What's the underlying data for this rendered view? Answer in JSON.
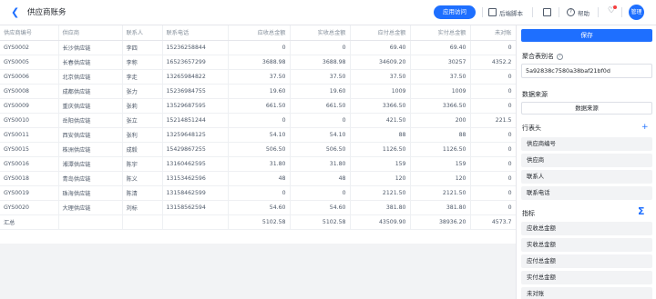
{
  "header": {
    "title": "供应商账务",
    "preview_label": "应用访问",
    "script_label": "后端脚本",
    "help_label": "帮助",
    "avatar_text": "管理"
  },
  "table": {
    "columns": [
      "供应商编号",
      "供应商",
      "联系人",
      "联系电话",
      "应收总金额",
      "实收总金额",
      "应付总金额",
      "实付总金额",
      "未对账"
    ],
    "rows": [
      [
        "GYS0002",
        "长沙供应链",
        "李四",
        "15236258844",
        "0",
        "0",
        "69.40",
        "69.40",
        "0"
      ],
      [
        "GYS0005",
        "长春供应链",
        "李称",
        "16523657299",
        "3688.98",
        "3688.98",
        "34609.20",
        "30257",
        "4352.2"
      ],
      [
        "GYS0006",
        "北京供应链",
        "李走",
        "13265984822",
        "37.50",
        "37.50",
        "37.50",
        "37.50",
        "0"
      ],
      [
        "GYS0008",
        "成都供应链",
        "张力",
        "15236984755",
        "19.60",
        "19.60",
        "1009",
        "1009",
        "0"
      ],
      [
        "GYS0009",
        "重庆供应链",
        "张莉",
        "13529687595",
        "661.50",
        "661.50",
        "3366.50",
        "3366.50",
        "0"
      ],
      [
        "GYS0010",
        "岳阳供应链",
        "张立",
        "15214851244",
        "0",
        "0",
        "421.50",
        "200",
        "221.5"
      ],
      [
        "GYS0011",
        "西安供应链",
        "张利",
        "13259648125",
        "54.10",
        "54.10",
        "88",
        "88",
        "0"
      ],
      [
        "GYS0015",
        "株洲供应链",
        "成毅",
        "15429867255",
        "506.50",
        "506.50",
        "1126.50",
        "1126.50",
        "0"
      ],
      [
        "GYS0016",
        "湘潭供应链",
        "陈宇",
        "13160462595",
        "31.80",
        "31.80",
        "159",
        "159",
        "0"
      ],
      [
        "GYS0018",
        "青岛供应链",
        "陈义",
        "13153462596",
        "48",
        "48",
        "120",
        "120",
        "0"
      ],
      [
        "GYS0019",
        "珠海供应链",
        "陈清",
        "13158462599",
        "0",
        "0",
        "2121.50",
        "2121.50",
        "0"
      ],
      [
        "GYS0020",
        "大理供应链",
        "刘标",
        "13158562594",
        "54.60",
        "54.60",
        "381.80",
        "381.80",
        "0"
      ]
    ],
    "total": [
      "汇总",
      "",
      "",
      "",
      "5102.58",
      "5102.58",
      "43509.90",
      "38936.20",
      "4573.7"
    ]
  },
  "panel": {
    "save_label": "保存",
    "name_label": "聚合表别名",
    "name_value": "5a92838c7580a38baf21bf0d",
    "source_label": "数据来源",
    "source_button": "数据来源",
    "row_header_label": "行表头",
    "row_headers": [
      "供应商编号",
      "供应商",
      "联系人",
      "联系电话"
    ],
    "metrics_label": "指标",
    "metrics": [
      "应收总金额",
      "实收总金额",
      "应付总金额",
      "实付总金额",
      "未对账"
    ]
  },
  "colors": {
    "accent": "#1e6fff",
    "background": "#f2f3f5"
  }
}
